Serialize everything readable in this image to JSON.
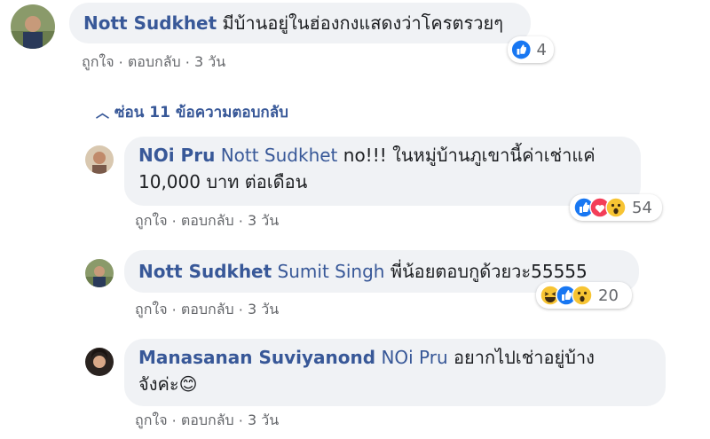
{
  "comments": [
    {
      "author": "Nott Sudkhet",
      "mention": "",
      "text": "มีบ้านอยู่ในฮ่องกงแสดงว่าโครตรวยๆ",
      "like": "ถูกใจ",
      "reply": "ตอบกลับ",
      "time": "3 วัน",
      "reaction_count": "4"
    },
    {
      "author": "NOi Pru",
      "mention": "Nott Sudkhet",
      "text_line1": "no!!! ในหมู่บ้านภูเขานี้ค่าเช่าแค่",
      "text_line2": "10,000 บาท ต่อเดือน",
      "like": "ถูกใจ",
      "reply": "ตอบกลับ",
      "time": "3 วัน",
      "reaction_count": "54"
    },
    {
      "author": "Nott Sudkhet",
      "mention": "Sumit Singh",
      "text": "พี่น้อยตอบกูด้วยวะ55555",
      "like": "ถูกใจ",
      "reply": "ตอบกลับ",
      "time": "3 วัน",
      "reaction_count": "20"
    },
    {
      "author": "Manasanan Suviyanond",
      "mention": "NOi Pru",
      "text_line1": "อยากไปเช่าอยู่บ้าง",
      "text_line2": "จังค่ะ😊",
      "like": "ถูกใจ",
      "reply": "ตอบกลับ",
      "time": "3 วัน"
    }
  ],
  "replies_toggle": "ซ่อน 11 ข้อความตอบกลับ",
  "separator": "·",
  "colors": {
    "link": "#385898",
    "bubble": "#f0f2f5",
    "meta": "#65676b",
    "like": "#1877f2"
  }
}
